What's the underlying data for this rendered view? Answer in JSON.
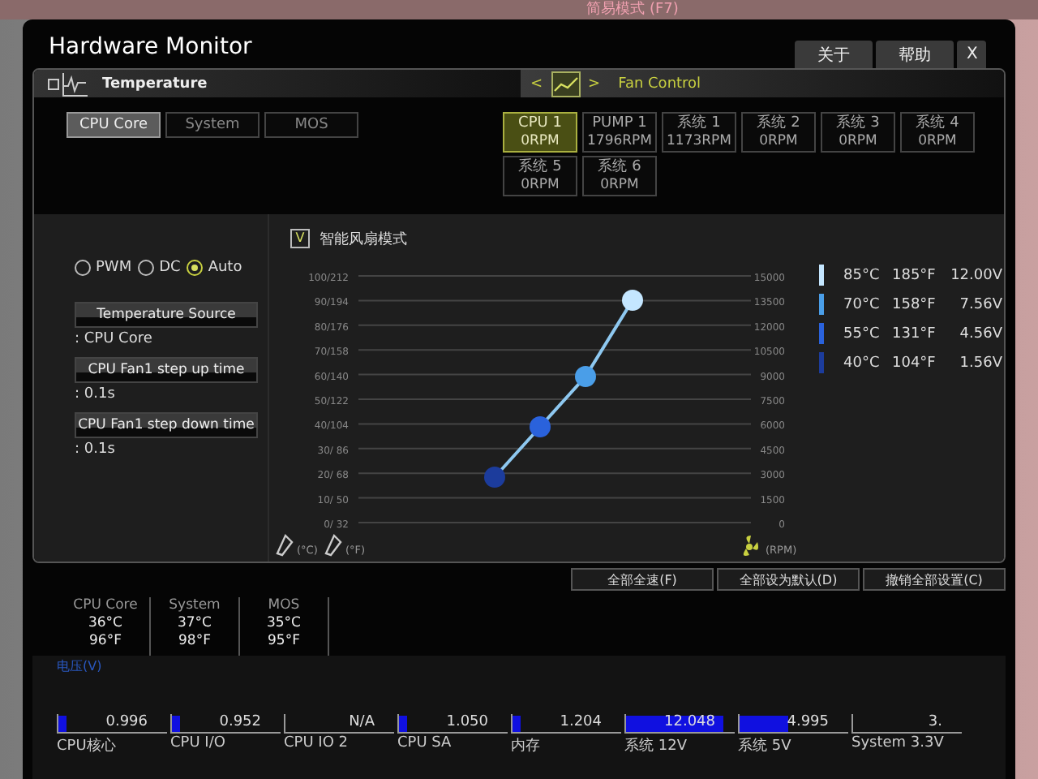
{
  "background": {
    "mode_label": "简易模式 (F7)"
  },
  "window": {
    "title": "Hardware Monitor",
    "buttons": [
      {
        "label": "关于",
        "kind": "text"
      },
      {
        "label": "帮助",
        "kind": "text"
      },
      {
        "label": "X",
        "kind": "close"
      }
    ]
  },
  "temperature_header": {
    "label": "Temperature"
  },
  "fan_header": {
    "label": "Fan Control",
    "prev": "<",
    "next": ">"
  },
  "sensor_tabs": [
    {
      "label": "CPU Core",
      "selected": true
    },
    {
      "label": "System",
      "selected": false
    },
    {
      "label": "MOS",
      "selected": false
    }
  ],
  "fans": [
    {
      "name": "CPU 1",
      "rpm": "0RPM",
      "selected": true
    },
    {
      "name": "PUMP 1",
      "rpm": "1796RPM",
      "selected": false
    },
    {
      "name": "系统 1",
      "rpm": "1173RPM",
      "selected": false
    },
    {
      "name": "系统 2",
      "rpm": "0RPM",
      "selected": false
    },
    {
      "name": "系统 3",
      "rpm": "0RPM",
      "selected": false
    },
    {
      "name": "系统 4",
      "rpm": "0RPM",
      "selected": false
    },
    {
      "name": "系统 5",
      "rpm": "0RPM",
      "selected": false
    },
    {
      "name": "系统 6",
      "rpm": "0RPM",
      "selected": false
    }
  ],
  "modes": [
    {
      "label": "PWM",
      "selected": false
    },
    {
      "label": "DC",
      "selected": false
    },
    {
      "label": "Auto",
      "selected": true
    }
  ],
  "settings": [
    {
      "label": "Temperature Source",
      "value": ": CPU Core"
    },
    {
      "label": "CPU Fan1 step up time",
      "value": ": 0.1s"
    },
    {
      "label": "CPU Fan1 step down time",
      "value": ": 0.1s"
    }
  ],
  "smart_fan": {
    "label": "智能风扇模式",
    "checked": true,
    "check_mark": "V",
    "temperature_ticks": [
      "100/212",
      "90/194",
      "80/176",
      "70/158",
      "60/140",
      "50/122",
      "40/104",
      "30/ 86",
      "20/ 68",
      "10/ 50",
      "0/ 32"
    ],
    "rpm_ticks": [
      "15000",
      "13500",
      "12000",
      "10500",
      "9000",
      "7500",
      "6000",
      "4500",
      "3000",
      "1500",
      "0"
    ],
    "celsius_label": "(°C)",
    "fahrenheit_label": "(°F)",
    "rpm_label": "(RPM)"
  },
  "curve_legend": [
    {
      "color": "#c4e6ff",
      "temp_c": "85°C",
      "temp_f": "185°F",
      "voltage": "12.00V"
    },
    {
      "color": "#4a9ee8",
      "temp_c": "70°C",
      "temp_f": "158°F",
      "voltage": "7.56V"
    },
    {
      "color": "#2a62dc",
      "temp_c": "55°C",
      "temp_f": "131°F",
      "voltage": "4.56V"
    },
    {
      "color": "#1c3c9c",
      "temp_c": "40°C",
      "temp_f": "104°F",
      "voltage": "1.56V"
    }
  ],
  "actions": [
    "全部全速(F)",
    "全部设为默认(D)",
    "撤销全部设置(C)"
  ],
  "temperatures": [
    {
      "name": "CPU Core",
      "celsius": "36°C",
      "fahrenheit": "96°F"
    },
    {
      "name": "System",
      "celsius": "37°C",
      "fahrenheit": "98°F"
    },
    {
      "name": "MOS",
      "celsius": "35°C",
      "fahrenheit": "95°F"
    }
  ],
  "voltage": {
    "title": "电压(V)",
    "items": [
      {
        "label": "CPU核心",
        "value": "0.996",
        "level": 0.08
      },
      {
        "label": "CPU I/O",
        "value": "0.952",
        "level": 0.08
      },
      {
        "label": "CPU IO 2",
        "value": "N/A"
      },
      {
        "label": "CPU SA",
        "value": "1.050",
        "level": 0.08
      },
      {
        "label": "内存",
        "value": "1.204",
        "level": 0.08
      },
      {
        "label": "系统 12V",
        "value": "12.048",
        "level": 0.9
      },
      {
        "label": "系统 5V",
        "value": "4.995",
        "level": 0.45
      },
      {
        "label": "System 3.3V",
        "value": "3."
      }
    ]
  }
}
